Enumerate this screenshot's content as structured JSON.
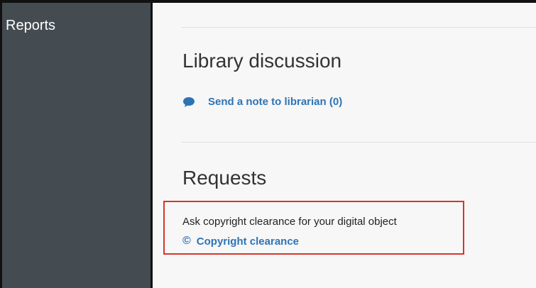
{
  "sidebar": {
    "items": [
      {
        "label": "Reports"
      }
    ]
  },
  "library_discussion": {
    "title": "Library discussion",
    "note_link": {
      "label": "Send a note to librarian (0)",
      "icon": "speech-bubble-icon"
    }
  },
  "requests": {
    "title": "Requests",
    "description": "Ask copyright clearance for your digital object",
    "copyright_link": {
      "label": "Copyright clearance",
      "icon": "copyright-icon",
      "icon_glyph": "©"
    }
  },
  "colors": {
    "sidebar_bg": "#454c51",
    "main_bg": "#f7f7f7",
    "link": "#2e74b5",
    "highlight_border": "#d9342b"
  }
}
